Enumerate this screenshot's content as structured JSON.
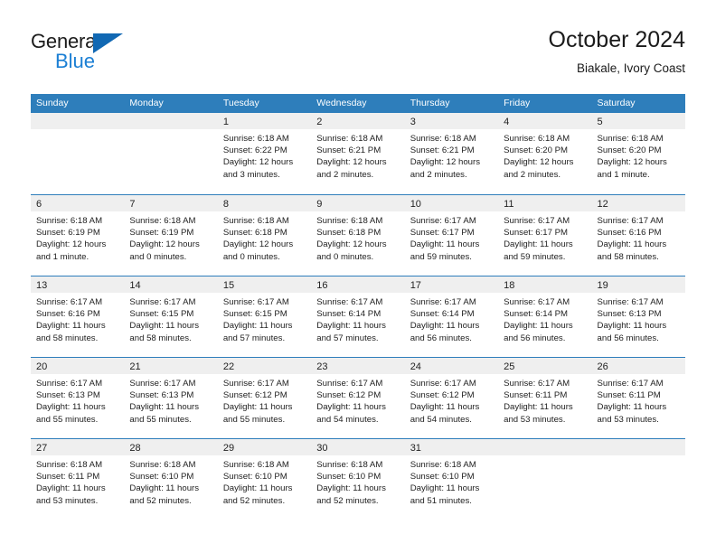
{
  "brand": {
    "name_part1": "General",
    "name_part2": "Blue",
    "triangle_icon": "triangle-icon",
    "accent_color": "#1168b3",
    "blue_color": "#1b7fd4"
  },
  "header": {
    "title": "October 2024",
    "subtitle": "Biakale, Ivory Coast"
  },
  "calendar": {
    "header_bg": "#2e7ebb",
    "day_band_bg": "#efefef",
    "weekdays": [
      "Sunday",
      "Monday",
      "Tuesday",
      "Wednesday",
      "Thursday",
      "Friday",
      "Saturday"
    ],
    "weeks": [
      [
        {
          "day": "",
          "sunrise": "",
          "sunset": "",
          "daylight_line1": "",
          "daylight_line2": ""
        },
        {
          "day": "",
          "sunrise": "",
          "sunset": "",
          "daylight_line1": "",
          "daylight_line2": ""
        },
        {
          "day": "1",
          "sunrise": "Sunrise: 6:18 AM",
          "sunset": "Sunset: 6:22 PM",
          "daylight_line1": "Daylight: 12 hours",
          "daylight_line2": "and 3 minutes."
        },
        {
          "day": "2",
          "sunrise": "Sunrise: 6:18 AM",
          "sunset": "Sunset: 6:21 PM",
          "daylight_line1": "Daylight: 12 hours",
          "daylight_line2": "and 2 minutes."
        },
        {
          "day": "3",
          "sunrise": "Sunrise: 6:18 AM",
          "sunset": "Sunset: 6:21 PM",
          "daylight_line1": "Daylight: 12 hours",
          "daylight_line2": "and 2 minutes."
        },
        {
          "day": "4",
          "sunrise": "Sunrise: 6:18 AM",
          "sunset": "Sunset: 6:20 PM",
          "daylight_line1": "Daylight: 12 hours",
          "daylight_line2": "and 2 minutes."
        },
        {
          "day": "5",
          "sunrise": "Sunrise: 6:18 AM",
          "sunset": "Sunset: 6:20 PM",
          "daylight_line1": "Daylight: 12 hours",
          "daylight_line2": "and 1 minute."
        }
      ],
      [
        {
          "day": "6",
          "sunrise": "Sunrise: 6:18 AM",
          "sunset": "Sunset: 6:19 PM",
          "daylight_line1": "Daylight: 12 hours",
          "daylight_line2": "and 1 minute."
        },
        {
          "day": "7",
          "sunrise": "Sunrise: 6:18 AM",
          "sunset": "Sunset: 6:19 PM",
          "daylight_line1": "Daylight: 12 hours",
          "daylight_line2": "and 0 minutes."
        },
        {
          "day": "8",
          "sunrise": "Sunrise: 6:18 AM",
          "sunset": "Sunset: 6:18 PM",
          "daylight_line1": "Daylight: 12 hours",
          "daylight_line2": "and 0 minutes."
        },
        {
          "day": "9",
          "sunrise": "Sunrise: 6:18 AM",
          "sunset": "Sunset: 6:18 PM",
          "daylight_line1": "Daylight: 12 hours",
          "daylight_line2": "and 0 minutes."
        },
        {
          "day": "10",
          "sunrise": "Sunrise: 6:17 AM",
          "sunset": "Sunset: 6:17 PM",
          "daylight_line1": "Daylight: 11 hours",
          "daylight_line2": "and 59 minutes."
        },
        {
          "day": "11",
          "sunrise": "Sunrise: 6:17 AM",
          "sunset": "Sunset: 6:17 PM",
          "daylight_line1": "Daylight: 11 hours",
          "daylight_line2": "and 59 minutes."
        },
        {
          "day": "12",
          "sunrise": "Sunrise: 6:17 AM",
          "sunset": "Sunset: 6:16 PM",
          "daylight_line1": "Daylight: 11 hours",
          "daylight_line2": "and 58 minutes."
        }
      ],
      [
        {
          "day": "13",
          "sunrise": "Sunrise: 6:17 AM",
          "sunset": "Sunset: 6:16 PM",
          "daylight_line1": "Daylight: 11 hours",
          "daylight_line2": "and 58 minutes."
        },
        {
          "day": "14",
          "sunrise": "Sunrise: 6:17 AM",
          "sunset": "Sunset: 6:15 PM",
          "daylight_line1": "Daylight: 11 hours",
          "daylight_line2": "and 58 minutes."
        },
        {
          "day": "15",
          "sunrise": "Sunrise: 6:17 AM",
          "sunset": "Sunset: 6:15 PM",
          "daylight_line1": "Daylight: 11 hours",
          "daylight_line2": "and 57 minutes."
        },
        {
          "day": "16",
          "sunrise": "Sunrise: 6:17 AM",
          "sunset": "Sunset: 6:14 PM",
          "daylight_line1": "Daylight: 11 hours",
          "daylight_line2": "and 57 minutes."
        },
        {
          "day": "17",
          "sunrise": "Sunrise: 6:17 AM",
          "sunset": "Sunset: 6:14 PM",
          "daylight_line1": "Daylight: 11 hours",
          "daylight_line2": "and 56 minutes."
        },
        {
          "day": "18",
          "sunrise": "Sunrise: 6:17 AM",
          "sunset": "Sunset: 6:14 PM",
          "daylight_line1": "Daylight: 11 hours",
          "daylight_line2": "and 56 minutes."
        },
        {
          "day": "19",
          "sunrise": "Sunrise: 6:17 AM",
          "sunset": "Sunset: 6:13 PM",
          "daylight_line1": "Daylight: 11 hours",
          "daylight_line2": "and 56 minutes."
        }
      ],
      [
        {
          "day": "20",
          "sunrise": "Sunrise: 6:17 AM",
          "sunset": "Sunset: 6:13 PM",
          "daylight_line1": "Daylight: 11 hours",
          "daylight_line2": "and 55 minutes."
        },
        {
          "day": "21",
          "sunrise": "Sunrise: 6:17 AM",
          "sunset": "Sunset: 6:13 PM",
          "daylight_line1": "Daylight: 11 hours",
          "daylight_line2": "and 55 minutes."
        },
        {
          "day": "22",
          "sunrise": "Sunrise: 6:17 AM",
          "sunset": "Sunset: 6:12 PM",
          "daylight_line1": "Daylight: 11 hours",
          "daylight_line2": "and 55 minutes."
        },
        {
          "day": "23",
          "sunrise": "Sunrise: 6:17 AM",
          "sunset": "Sunset: 6:12 PM",
          "daylight_line1": "Daylight: 11 hours",
          "daylight_line2": "and 54 minutes."
        },
        {
          "day": "24",
          "sunrise": "Sunrise: 6:17 AM",
          "sunset": "Sunset: 6:12 PM",
          "daylight_line1": "Daylight: 11 hours",
          "daylight_line2": "and 54 minutes."
        },
        {
          "day": "25",
          "sunrise": "Sunrise: 6:17 AM",
          "sunset": "Sunset: 6:11 PM",
          "daylight_line1": "Daylight: 11 hours",
          "daylight_line2": "and 53 minutes."
        },
        {
          "day": "26",
          "sunrise": "Sunrise: 6:17 AM",
          "sunset": "Sunset: 6:11 PM",
          "daylight_line1": "Daylight: 11 hours",
          "daylight_line2": "and 53 minutes."
        }
      ],
      [
        {
          "day": "27",
          "sunrise": "Sunrise: 6:18 AM",
          "sunset": "Sunset: 6:11 PM",
          "daylight_line1": "Daylight: 11 hours",
          "daylight_line2": "and 53 minutes."
        },
        {
          "day": "28",
          "sunrise": "Sunrise: 6:18 AM",
          "sunset": "Sunset: 6:10 PM",
          "daylight_line1": "Daylight: 11 hours",
          "daylight_line2": "and 52 minutes."
        },
        {
          "day": "29",
          "sunrise": "Sunrise: 6:18 AM",
          "sunset": "Sunset: 6:10 PM",
          "daylight_line1": "Daylight: 11 hours",
          "daylight_line2": "and 52 minutes."
        },
        {
          "day": "30",
          "sunrise": "Sunrise: 6:18 AM",
          "sunset": "Sunset: 6:10 PM",
          "daylight_line1": "Daylight: 11 hours",
          "daylight_line2": "and 52 minutes."
        },
        {
          "day": "31",
          "sunrise": "Sunrise: 6:18 AM",
          "sunset": "Sunset: 6:10 PM",
          "daylight_line1": "Daylight: 11 hours",
          "daylight_line2": "and 51 minutes."
        },
        {
          "day": "",
          "sunrise": "",
          "sunset": "",
          "daylight_line1": "",
          "daylight_line2": ""
        },
        {
          "day": "",
          "sunrise": "",
          "sunset": "",
          "daylight_line1": "",
          "daylight_line2": ""
        }
      ]
    ]
  }
}
